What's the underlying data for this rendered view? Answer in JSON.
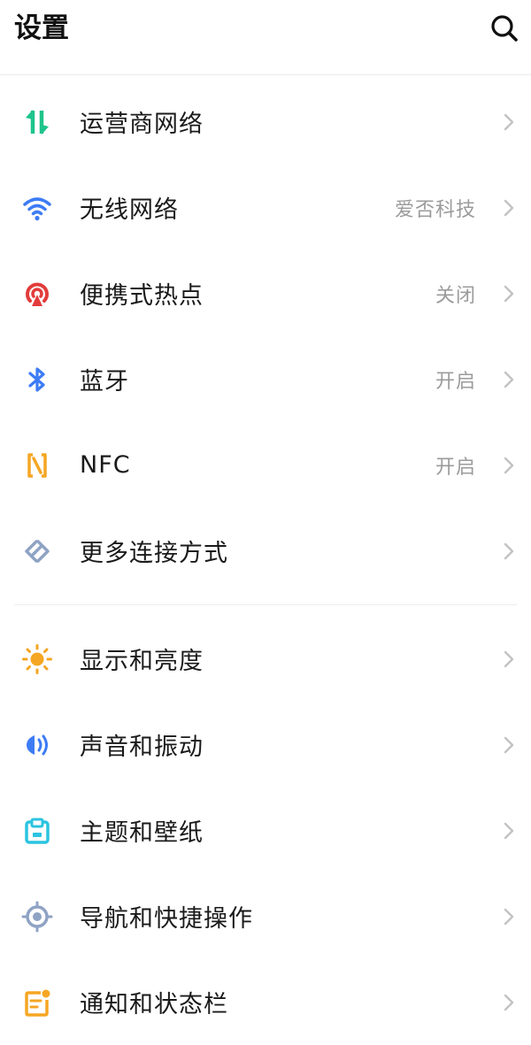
{
  "header": {
    "title": "设置",
    "search_icon": "search-icon"
  },
  "connectivity": [
    {
      "id": "carrier",
      "label": "运营商网络",
      "value": "",
      "icon": "carrier-icon",
      "color": "#1fc48b"
    },
    {
      "id": "wifi",
      "label": "无线网络",
      "value": "爱否科技",
      "icon": "wifi-icon",
      "color": "#3d7cf5"
    },
    {
      "id": "hotspot",
      "label": "便携式热点",
      "value": "关闭",
      "icon": "hotspot-icon",
      "color": "#e23c3c"
    },
    {
      "id": "bluetooth",
      "label": "蓝牙",
      "value": "开启",
      "icon": "bluetooth-icon",
      "color": "#3d7cf5"
    },
    {
      "id": "nfc",
      "label": "NFC",
      "value": "开启",
      "icon": "nfc-icon",
      "color": "#f5a623"
    },
    {
      "id": "more",
      "label": "更多连接方式",
      "value": "",
      "icon": "link-icon",
      "color": "#8fa3c4"
    }
  ],
  "personalization": [
    {
      "id": "display",
      "label": "显示和亮度",
      "value": "",
      "icon": "sun-icon",
      "color": "#f5a623"
    },
    {
      "id": "sound",
      "label": "声音和振动",
      "value": "",
      "icon": "speaker-icon",
      "color": "#3d7cf5"
    },
    {
      "id": "theme",
      "label": "主题和壁纸",
      "value": "",
      "icon": "theme-icon",
      "color": "#2bc4e0"
    },
    {
      "id": "navigation",
      "label": "导航和快捷操作",
      "value": "",
      "icon": "navigation-icon",
      "color": "#8fa3c4"
    },
    {
      "id": "notify",
      "label": "通知和状态栏",
      "value": "",
      "icon": "notification-icon",
      "color": "#f5a623"
    }
  ]
}
